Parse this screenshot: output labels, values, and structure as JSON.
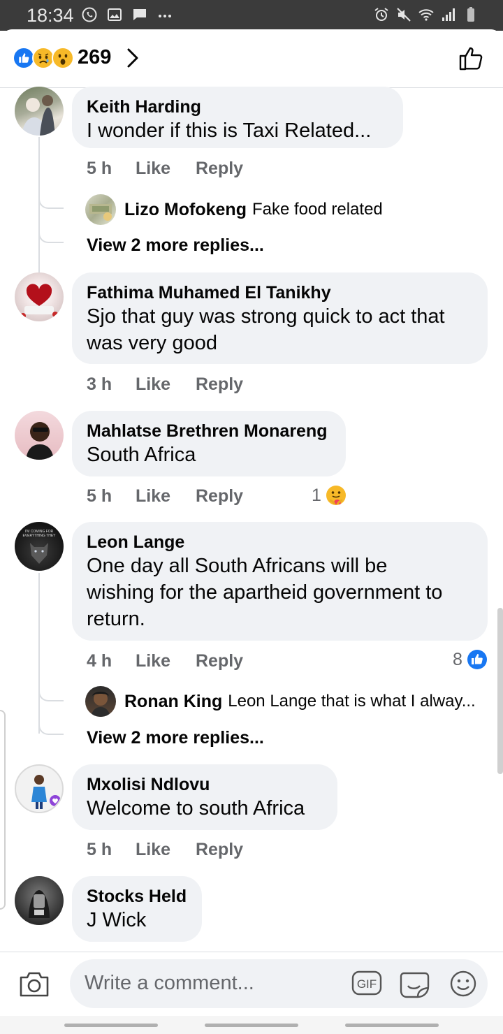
{
  "status_bar": {
    "time": "18:34",
    "left_icons": [
      "whatsapp-icon",
      "image-icon",
      "chat-icon",
      "more-dots-icon"
    ],
    "right_icons": [
      "alarm-icon",
      "mute-icon",
      "wifi-icon",
      "signal-icon",
      "battery-icon"
    ]
  },
  "reactions": {
    "icons": [
      "like-reaction-icon",
      "sad-reaction-icon",
      "wow-reaction-icon"
    ],
    "count": "269"
  },
  "comments": [
    {
      "author": "Keith Harding",
      "text": "I wonder if this is Taxi Related...",
      "time": "5 h",
      "like_label": "Like",
      "reply_label": "Reply",
      "reply_preview": {
        "author": "Lizo Mofokeng",
        "text": "Fake food related"
      },
      "more_replies": "View 2 more replies..."
    },
    {
      "author": "Fathima Muhamed El Tanikhy",
      "text_lines": [
        "Sjo that guy was strong quick to act that",
        "was very good"
      ],
      "time": "3 h",
      "like_label": "Like",
      "reply_label": "Reply"
    },
    {
      "author": "Mahlatse Brethren Monareng",
      "text": "South Africa",
      "time": "5 h",
      "like_label": "Like",
      "reply_label": "Reply",
      "reaction_count": "1",
      "reaction_icon": "care-reaction-icon"
    },
    {
      "author": "Leon Lange",
      "text_lines": [
        "One day all South Africans will be",
        "wishing for the apartheid government to",
        "return."
      ],
      "time": "4 h",
      "like_label": "Like",
      "reply_label": "Reply",
      "reaction_count": "8",
      "reaction_icon": "like-reaction-icon",
      "reply_preview": {
        "author": "Ronan King",
        "text": "Leon Lange that is what I alway..."
      },
      "more_replies": "View 2 more replies..."
    },
    {
      "author": "Mxolisi Ndlovu",
      "text": "Welcome to south Africa",
      "time": "5 h",
      "like_label": "Like",
      "reply_label": "Reply"
    },
    {
      "author": "Stocks Held",
      "text": "J Wick"
    }
  ],
  "composer": {
    "placeholder": "Write a comment...",
    "gif_label": "GIF"
  },
  "colors": {
    "accent": "#1877f2",
    "bubble": "#f0f2f5",
    "meta_text": "#65676b"
  }
}
